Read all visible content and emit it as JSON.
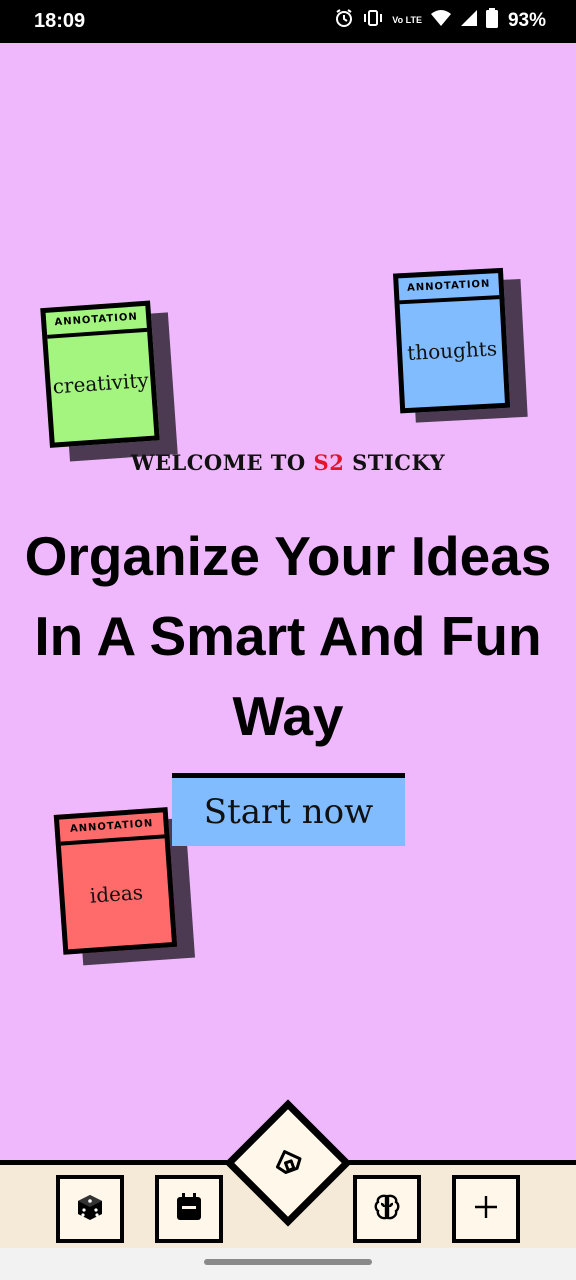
{
  "status_bar": {
    "time": "18:09",
    "battery": "93%",
    "network_label": "Vo LTE"
  },
  "notes": {
    "creativity": {
      "tag": "ANNOTATION",
      "word": "creativity",
      "color": "#a3f57f"
    },
    "thoughts": {
      "tag": "ANNOTATION",
      "word": "thoughts",
      "color": "#80bcff"
    },
    "ideas": {
      "tag": "ANNOTATION",
      "word": "ideas",
      "color": "#ff6b6b"
    }
  },
  "welcome": {
    "prefix": "WELCOME TO ",
    "brand": "S2",
    "suffix": " STICKY",
    "brand_color": "#e3142a"
  },
  "headline": "Organize Your Ideas In A Smart And Fun Way",
  "start_button": "Start now",
  "nav": {
    "items": [
      {
        "icon": "dice-icon"
      },
      {
        "icon": "calendar-icon"
      },
      {
        "icon": "home-icon"
      },
      {
        "icon": "brain-icon"
      },
      {
        "icon": "plus-icon"
      }
    ]
  },
  "colors": {
    "background": "#f0b8fc",
    "navbar": "#f5ead8",
    "accent_blue": "#80bcff"
  }
}
